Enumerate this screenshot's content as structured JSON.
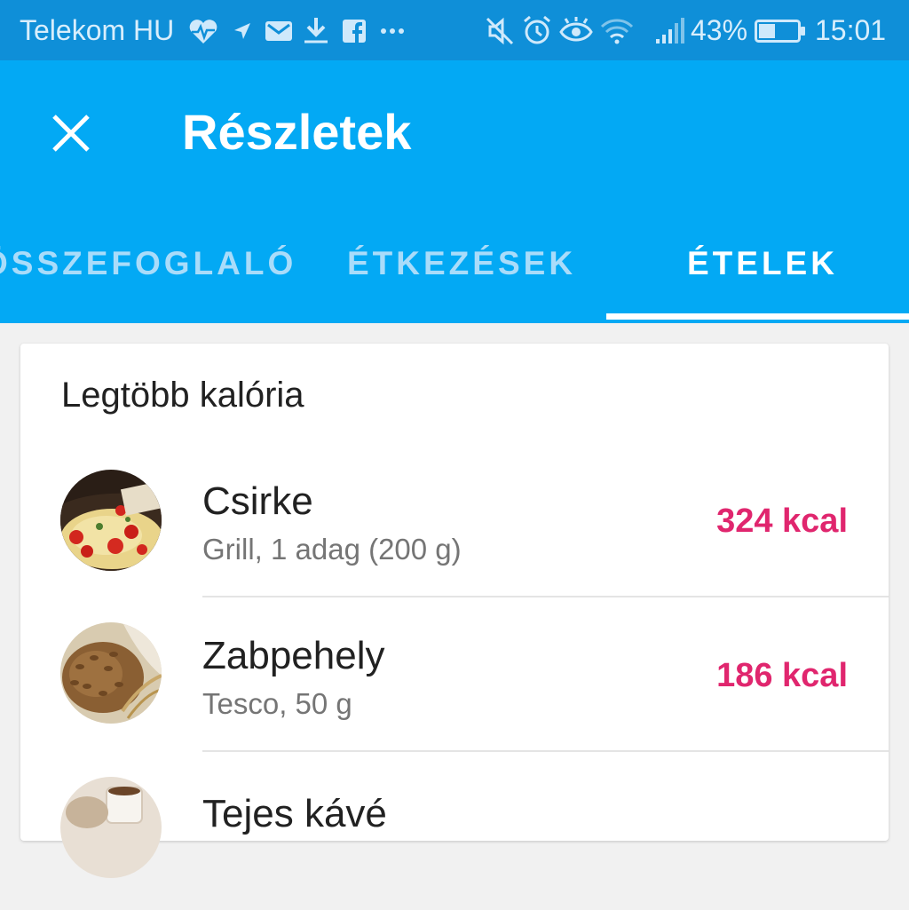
{
  "status_bar": {
    "carrier": "Telekom HU",
    "battery_percent": "43%",
    "time": "15:01",
    "battery_level": 0.43,
    "icons": [
      "heart-pulse-icon",
      "navigation-icon",
      "mail-icon",
      "download-icon",
      "facebook-icon",
      "more-dots-icon",
      "mute-icon",
      "alarm-icon",
      "eye-icon",
      "wifi-icon",
      "signal-icon",
      "battery-icon"
    ]
  },
  "app_bar": {
    "title": "Részletek",
    "close_icon": "close-icon",
    "color": "#03a9f4"
  },
  "tabs": [
    {
      "label": "ÖSSZEFOGLALÓ",
      "active": false
    },
    {
      "label": "ÉTKEZÉSEK",
      "active": false
    },
    {
      "label": "ÉTELEK",
      "active": true
    }
  ],
  "card": {
    "title": "Legtöbb kalória",
    "items": [
      {
        "name": "Csirke",
        "detail": "Grill, 1 adag (200 g)",
        "kcal": "324 kcal",
        "thumb": "pizza-photo"
      },
      {
        "name": "Zabpehely",
        "detail": "Tesco, 50 g",
        "kcal": "186 kcal",
        "thumb": "oats-photo"
      },
      {
        "name": "Tejes kávé",
        "detail": "",
        "kcal": "",
        "thumb": "coffee-photo"
      }
    ]
  },
  "colors": {
    "accent_kcal": "#e0266e",
    "status_bar": "#0f8fd8",
    "tab_inactive": "#a9dcfa"
  }
}
